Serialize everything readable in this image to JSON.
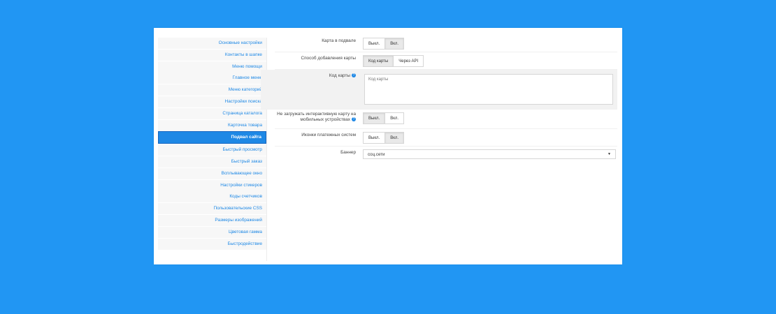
{
  "sidebar": {
    "items": [
      {
        "label": "Основные настройки"
      },
      {
        "label": "Контакты в шапке"
      },
      {
        "label": "Меню помощи"
      },
      {
        "label": "Главное меню"
      },
      {
        "label": "Меню категорий"
      },
      {
        "label": "Настройки поиска"
      },
      {
        "label": "Страница каталога"
      },
      {
        "label": "Карточка товара"
      },
      {
        "label": "Подвал сайта"
      },
      {
        "label": "Быстрый просмотр"
      },
      {
        "label": "Быстрый заказ"
      },
      {
        "label": "Всплывающее окно"
      },
      {
        "label": "Настройки стикеров"
      },
      {
        "label": "Коды счетчиков"
      },
      {
        "label": "Пользовательские CSS"
      },
      {
        "label": "Размеры изображений"
      },
      {
        "label": "Цветовая гамма"
      },
      {
        "label": "Быстродействие"
      }
    ],
    "active_index": 8
  },
  "settings": {
    "map_footer": {
      "label": "Карта в подвале",
      "off": "Выкл.",
      "on": "Вкл.",
      "selected": "on"
    },
    "map_method": {
      "label": "Способ добавления карты",
      "opt1": "Код карты",
      "opt2": "Через API",
      "selected": "opt1"
    },
    "map_code": {
      "label": "Код карты",
      "help": "?",
      "placeholder": "Код карты"
    },
    "mobile_map": {
      "label": "Не загружать интерактивную карту на мобильных устройствах",
      "help": "?",
      "off": "Выкл.",
      "on": "Вкл.",
      "selected": "off"
    },
    "payment_icons": {
      "label": "Иконки платежных систем",
      "off": "Выкл.",
      "on": "Вкл.",
      "selected": "on"
    },
    "banner": {
      "label": "Баннер",
      "value": "соц.сети"
    }
  }
}
